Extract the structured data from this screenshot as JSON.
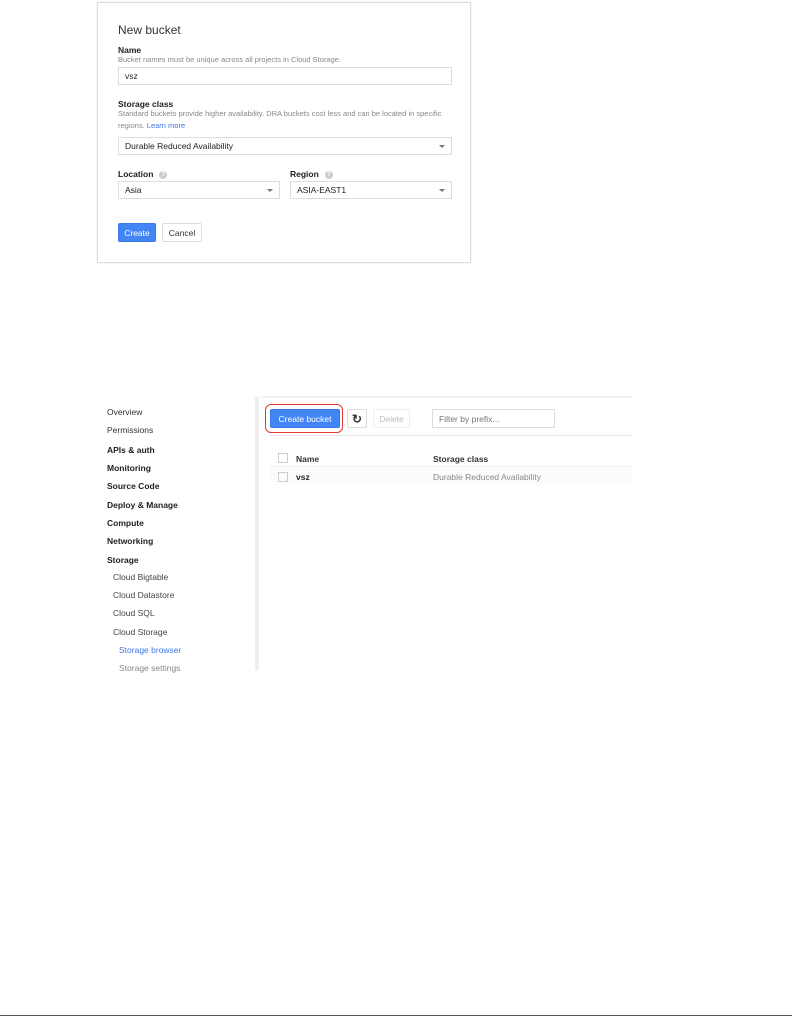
{
  "dialog": {
    "title": "New bucket",
    "name_label": "Name",
    "name_hint": "Bucket names must be unique across all projects in Cloud Storage.",
    "name_value": "vsz",
    "storage_class_label": "Storage class",
    "storage_class_hint": "Standard buckets provide higher availability. DRA buckets cost less and can be located in specific regions.",
    "learn_more": "Learn more",
    "storage_class_value": "Durable Reduced Availability",
    "location_label": "Location",
    "location_value": "Asia",
    "region_label": "Region",
    "region_value": "ASIA-EAST1",
    "help_icon": "?",
    "create": "Create",
    "cancel": "Cancel"
  },
  "sidebar": {
    "items": [
      {
        "label": "Overview",
        "level": "top"
      },
      {
        "label": "Permissions",
        "level": "top"
      },
      {
        "label": "APIs & auth",
        "level": "section"
      },
      {
        "label": "Monitoring",
        "level": "section"
      },
      {
        "label": "Source Code",
        "level": "section"
      },
      {
        "label": "Deploy & Manage",
        "level": "section"
      },
      {
        "label": "Compute",
        "level": "section"
      },
      {
        "label": "Networking",
        "level": "section"
      },
      {
        "label": "Storage",
        "level": "section"
      },
      {
        "label": "Cloud Bigtable",
        "level": "sub"
      },
      {
        "label": "Cloud Datastore",
        "level": "sub"
      },
      {
        "label": "Cloud SQL",
        "level": "sub"
      },
      {
        "label": "Cloud Storage",
        "level": "sub"
      },
      {
        "label": "Storage browser",
        "level": "subsub",
        "active": true
      },
      {
        "label": "Storage settings",
        "level": "subsub"
      }
    ]
  },
  "toolbar": {
    "create_bucket": "Create bucket",
    "delete": "Delete",
    "filter_placeholder": "Filter by prefix...",
    "highlight_color": "#e53935"
  },
  "table": {
    "headers": [
      "Name",
      "Storage class"
    ],
    "rows": [
      {
        "name": "vsz",
        "storage_class": "Durable Reduced Availability"
      }
    ]
  }
}
